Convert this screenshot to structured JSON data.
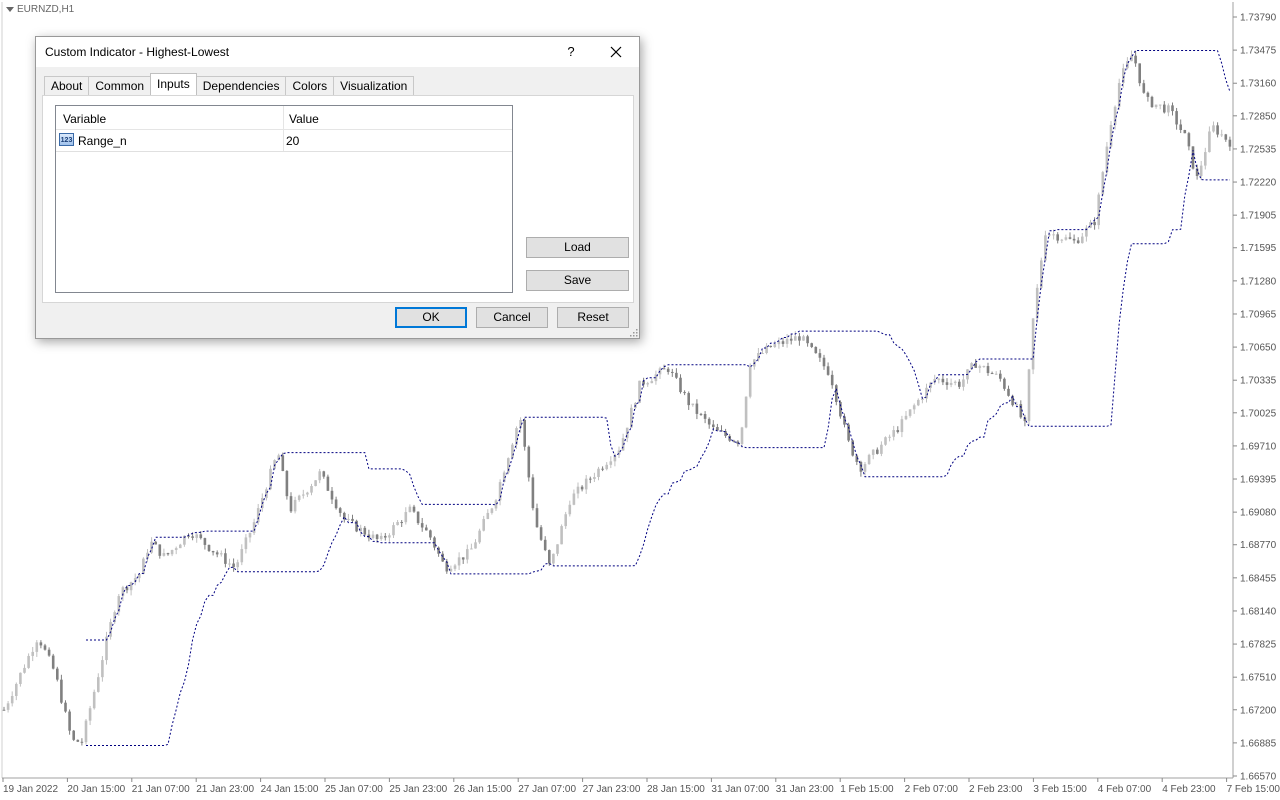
{
  "chart": {
    "symbol": "EURNZD,H1",
    "price_levels": [
      "1.73790",
      "1.73475",
      "1.73160",
      "1.72850",
      "1.72535",
      "1.72220",
      "1.71905",
      "1.71595",
      "1.71280",
      "1.70965",
      "1.70650",
      "1.70335",
      "1.70025",
      "1.69710",
      "1.69395",
      "1.69080",
      "1.68770",
      "1.68455",
      "1.68140",
      "1.67825",
      "1.67510",
      "1.67200",
      "1.66885",
      "1.66570"
    ],
    "time_labels": [
      "19 Jan 2022",
      "20 Jan 15:00",
      "21 Jan 07:00",
      "21 Jan 23:00",
      "24 Jan 15:00",
      "25 Jan 07:00",
      "25 Jan 23:00",
      "26 Jan 15:00",
      "27 Jan 07:00",
      "27 Jan 23:00",
      "28 Jan 15:00",
      "31 Jan 07:00",
      "31 Jan 23:00",
      "1 Feb 15:00",
      "2 Feb 07:00",
      "2 Feb 23:00",
      "3 Feb 15:00",
      "4 Feb 07:00",
      "4 Feb 23:00",
      "7 Feb 15:00"
    ],
    "colors": {
      "bull": "#c0c0c0",
      "bear": "#808080",
      "channel": "#000080",
      "grid": "#c8c8c8"
    }
  },
  "dialog": {
    "title": "Custom Indicator - Highest-Lowest",
    "help": "?",
    "tabs": [
      {
        "label": "About"
      },
      {
        "label": "Common"
      },
      {
        "label": "Inputs",
        "active": true
      },
      {
        "label": "Dependencies"
      },
      {
        "label": "Colors"
      },
      {
        "label": "Visualization"
      }
    ],
    "grid": {
      "col_variable": "Variable",
      "col_value": "Value",
      "rows": [
        {
          "icon_text": "123",
          "name": "Range_n",
          "value": "20"
        }
      ]
    },
    "buttons": {
      "load": "Load",
      "save": "Save",
      "ok": "OK",
      "cancel": "Cancel",
      "reset": "Reset"
    }
  }
}
